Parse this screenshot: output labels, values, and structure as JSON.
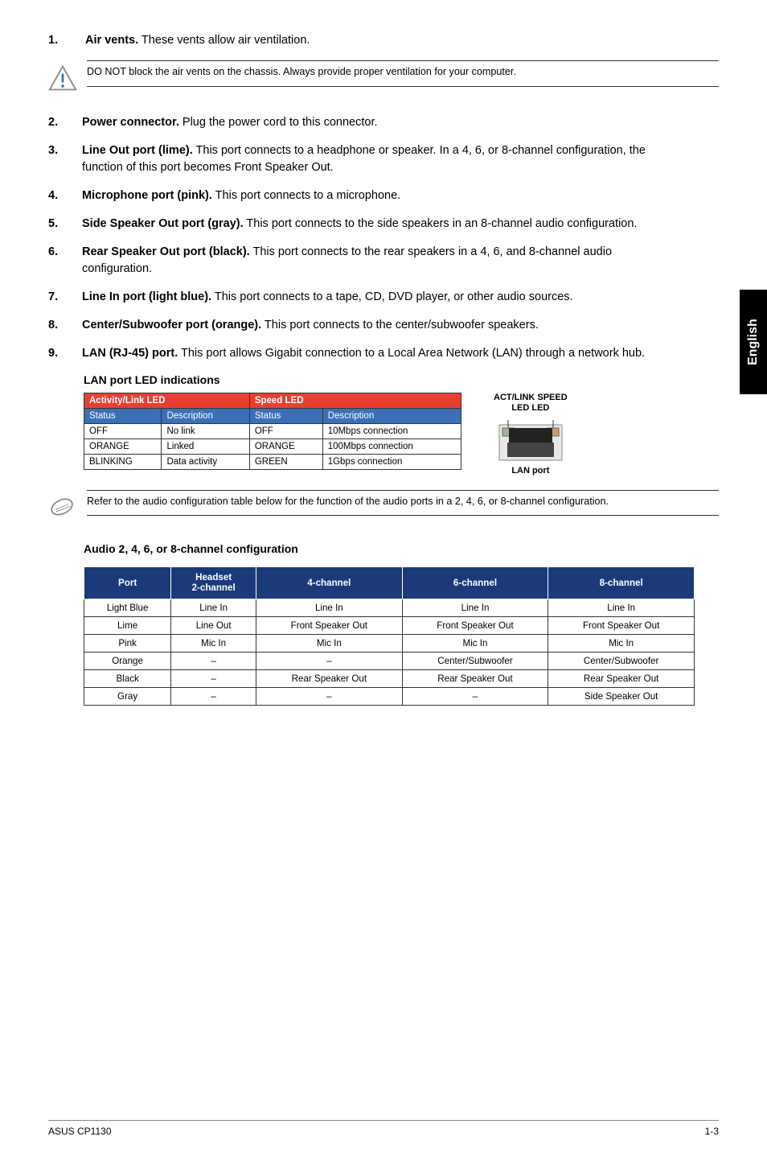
{
  "sideTab": "English",
  "items": [
    {
      "num": "1.",
      "title": "Air vents.",
      "desc": " These vents allow air ventilation."
    },
    {
      "num": "2.",
      "title": "Power connector.",
      "desc": " Plug the power cord to this connector."
    },
    {
      "num": "3.",
      "title": "Line Out port (lime).",
      "desc": " This port connects to a headphone or speaker. In a 4, 6, or 8-channel configuration, the function of this port becomes Front Speaker Out."
    },
    {
      "num": "4.",
      "title": "Microphone port (pink).",
      "desc": " This port connects to a microphone."
    },
    {
      "num": "5.",
      "title": "Side Speaker Out port (gray).",
      "desc": " This port connects to the side speakers in an 8-channel audio configuration."
    },
    {
      "num": "6.",
      "title": "Rear Speaker Out port (black).",
      "desc": " This port connects to the rear speakers in a 4, 6, and 8-channel audio configuration."
    },
    {
      "num": "7.",
      "title": "Line In port (light blue).",
      "desc": " This port connects to a tape, CD, DVD player, or other audio sources."
    },
    {
      "num": "8.",
      "title": "Center/Subwoofer port (orange).",
      "desc": " This port connects to the center/subwoofer speakers."
    },
    {
      "num": "9.",
      "title": "LAN (RJ-45) port.",
      "desc": " This port allows Gigabit connection to a Local Area Network (LAN) through a network hub."
    }
  ],
  "warningNote": "DO NOT block the air vents on the chassis. Always provide proper ventilation for your computer.",
  "ledSectionTitle": "LAN port LED indications",
  "ledTable": {
    "h1a": "Activity/Link LED",
    "h1b": "Speed LED",
    "h2": [
      "Status",
      "Description",
      "Status",
      "Description"
    ],
    "rows": [
      [
        "OFF",
        "No link",
        "OFF",
        "10Mbps connection"
      ],
      [
        "ORANGE",
        "Linked",
        "ORANGE",
        "100Mbps connection"
      ],
      [
        "BLINKING",
        "Data activity",
        "GREEN",
        "1Gbps connection"
      ]
    ]
  },
  "lanDiagram": {
    "top": "ACT/LINK  SPEED",
    "sub": "LED         LED",
    "caption": "LAN port"
  },
  "infoNote": "Refer to the audio configuration table below for the function of the audio ports in a 2, 4, 6, or 8-channel configuration.",
  "audioTitle": "Audio 2, 4, 6, or 8-channel configuration",
  "audioTable": {
    "headers": [
      "Port",
      "Headset\n2-channel",
      "4-channel",
      "6-channel",
      "8-channel"
    ],
    "rows": [
      [
        "Light Blue",
        "Line In",
        "Line In",
        "Line In",
        "Line In"
      ],
      [
        "Lime",
        "Line Out",
        "Front Speaker Out",
        "Front Speaker Out",
        "Front Speaker Out"
      ],
      [
        "Pink",
        "Mic In",
        "Mic In",
        "Mic In",
        "Mic In"
      ],
      [
        "Orange",
        "–",
        "–",
        "Center/Subwoofer",
        "Center/Subwoofer"
      ],
      [
        "Black",
        "–",
        "Rear Speaker Out",
        "Rear Speaker Out",
        "Rear Speaker Out"
      ],
      [
        "Gray",
        "–",
        "–",
        "–",
        "Side Speaker Out"
      ]
    ]
  },
  "footer": {
    "left": "ASUS CP1130",
    "right": "1-3"
  },
  "chart_data": {
    "type": "table",
    "tables": [
      {
        "title": "LAN port LED indications",
        "columns": [
          "Activity/Link LED Status",
          "Activity/Link LED Description",
          "Speed LED Status",
          "Speed LED Description"
        ],
        "rows": [
          [
            "OFF",
            "No link",
            "OFF",
            "10Mbps connection"
          ],
          [
            "ORANGE",
            "Linked",
            "ORANGE",
            "100Mbps connection"
          ],
          [
            "BLINKING",
            "Data activity",
            "GREEN",
            "1Gbps connection"
          ]
        ]
      },
      {
        "title": "Audio 2, 4, 6, or 8-channel configuration",
        "columns": [
          "Port",
          "Headset 2-channel",
          "4-channel",
          "6-channel",
          "8-channel"
        ],
        "rows": [
          [
            "Light Blue",
            "Line In",
            "Line In",
            "Line In",
            "Line In"
          ],
          [
            "Lime",
            "Line Out",
            "Front Speaker Out",
            "Front Speaker Out",
            "Front Speaker Out"
          ],
          [
            "Pink",
            "Mic In",
            "Mic In",
            "Mic In",
            "Mic In"
          ],
          [
            "Orange",
            "–",
            "–",
            "Center/Subwoofer",
            "Center/Subwoofer"
          ],
          [
            "Black",
            "–",
            "Rear Speaker Out",
            "Rear Speaker Out",
            "Rear Speaker Out"
          ],
          [
            "Gray",
            "–",
            "–",
            "–",
            "Side Speaker Out"
          ]
        ]
      }
    ]
  }
}
